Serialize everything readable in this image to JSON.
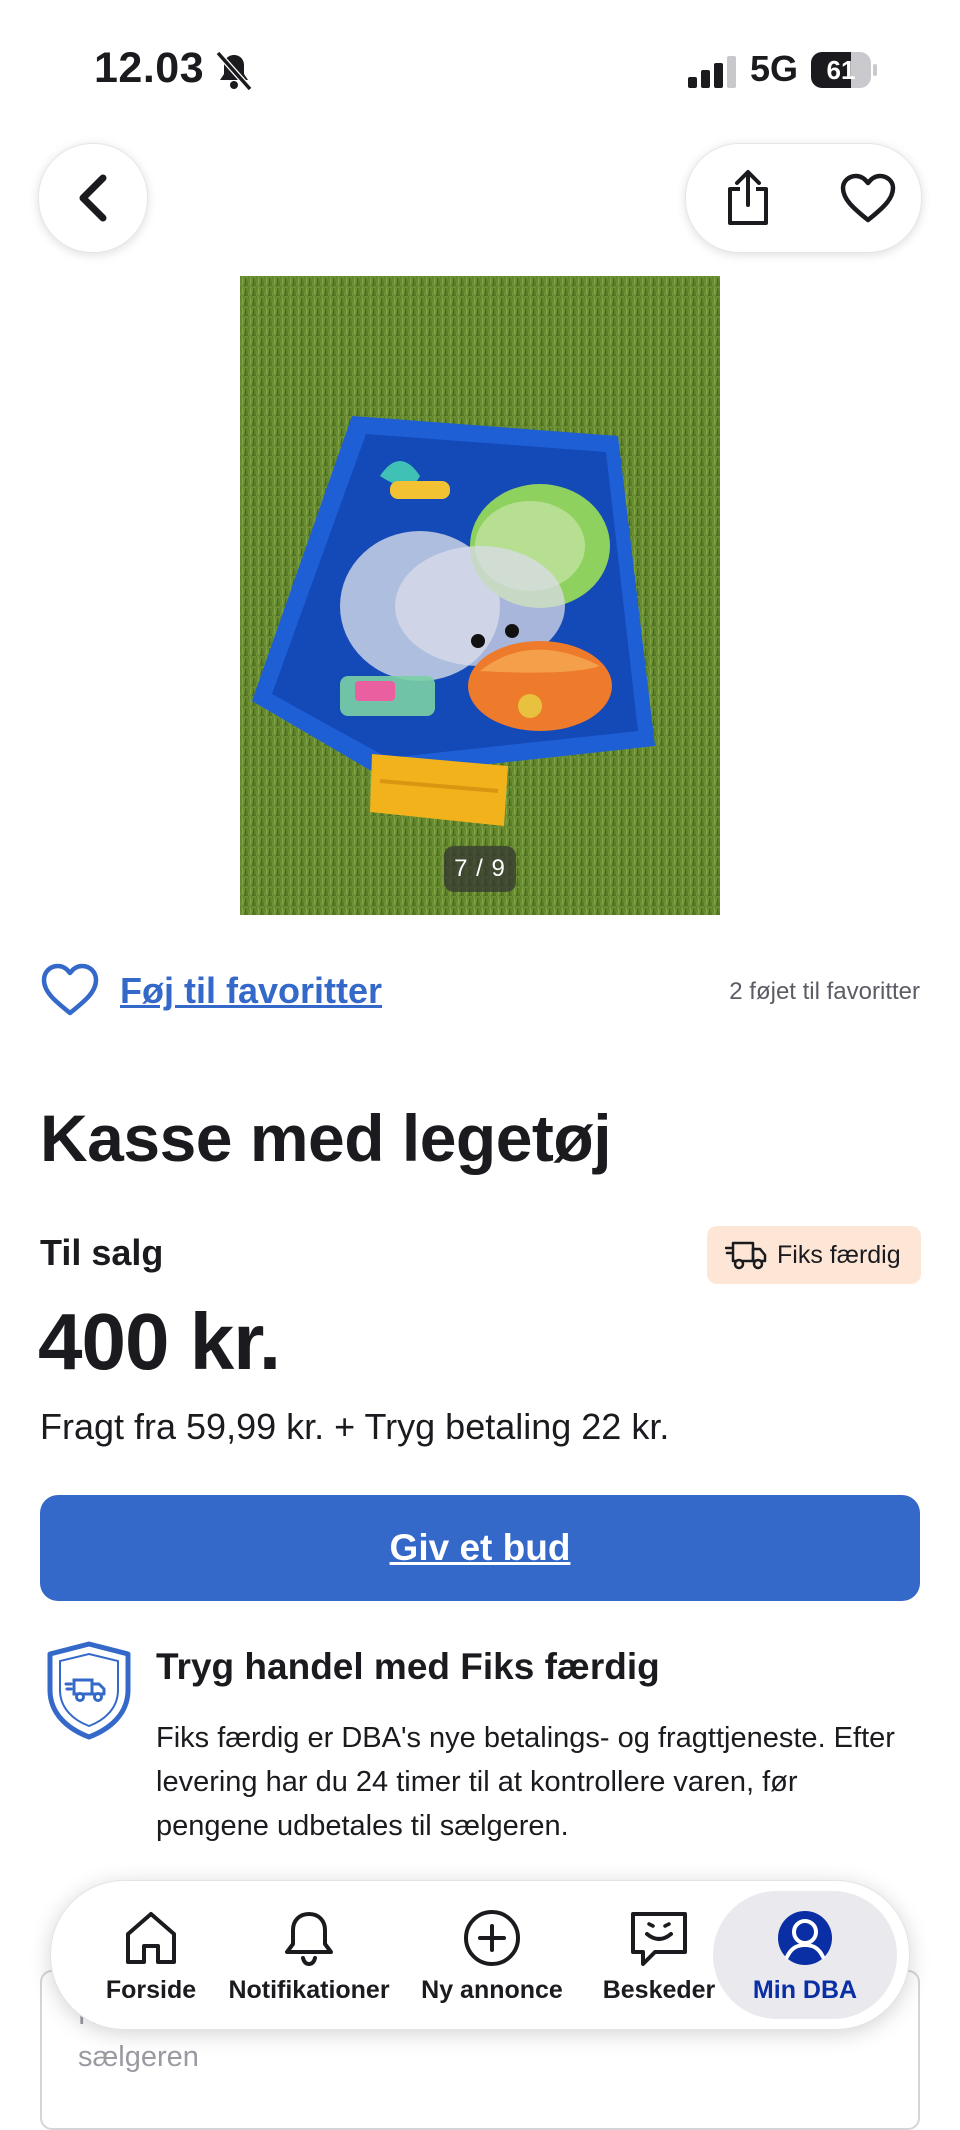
{
  "status_bar": {
    "time": "12.03",
    "network": "5G",
    "battery": "61"
  },
  "listing": {
    "image_counter": "7 / 9",
    "favorite_link": "Føj til favoritter",
    "favorite_count": "2 føjet til favoritter",
    "title": "Kasse med legetøj",
    "sale_type": "Til salg",
    "badge": "Fiks færdig",
    "price": "400 kr.",
    "shipping_line": "Fragt fra 59,99 kr. + Tryg betaling 22 kr.",
    "bid_button": "Giv et bud"
  },
  "trust": {
    "title": "Tryg handel med Fiks færdig",
    "text": "Fiks færdig er DBA's nye betalings- og fragttjeneste. Efter levering har du 24 timer til at kontrollere varen, før pengene udbetales til sælgeren."
  },
  "message": {
    "placeholder": "Hvis du har spørgsmål til varen, så send en besked til sælgeren"
  },
  "nav": {
    "items": [
      {
        "label": "Forside",
        "icon": "home-icon"
      },
      {
        "label": "Notifikationer",
        "icon": "bell-icon"
      },
      {
        "label": "Ny annonce",
        "icon": "plus-circle-icon"
      },
      {
        "label": "Beskeder",
        "icon": "chat-icon"
      },
      {
        "label": "Min DBA",
        "icon": "user-icon",
        "active": true
      }
    ]
  },
  "colors": {
    "accent": "#3469c9",
    "badge_bg": "#fde6d6",
    "active_nav": "#0a2ea4"
  }
}
